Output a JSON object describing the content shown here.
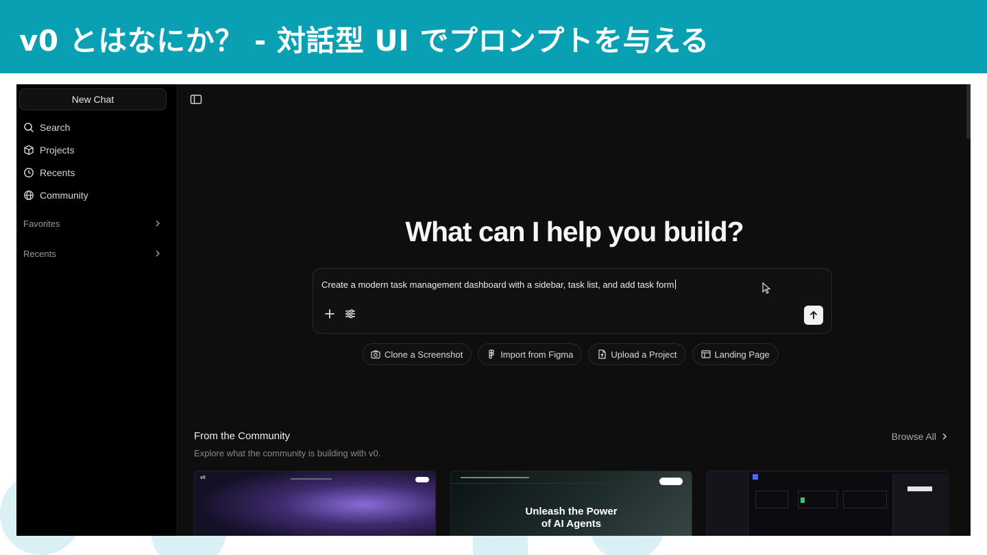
{
  "slide": {
    "title": "v0 とはなにか？ - 対話型 UI でプロンプトを与える"
  },
  "sidebar": {
    "new_chat": "New Chat",
    "items": [
      {
        "label": "Search",
        "icon": "search-icon"
      },
      {
        "label": "Projects",
        "icon": "cube-icon"
      },
      {
        "label": "Recents",
        "icon": "clock-icon"
      },
      {
        "label": "Community",
        "icon": "globe-icon"
      }
    ],
    "sections": [
      {
        "label": "Favorites",
        "icon": "chevron-right-icon"
      },
      {
        "label": "Recents",
        "icon": "chevron-right-icon"
      }
    ]
  },
  "main": {
    "heading": "What can I help you build?",
    "prompt_text": "Create a modern task management dashboard with a sidebar, task list, and add task form",
    "chips": [
      {
        "label": "Clone a Screenshot",
        "icon": "camera-icon"
      },
      {
        "label": "Import from Figma",
        "icon": "figma-icon"
      },
      {
        "label": "Upload a Project",
        "icon": "file-upload-icon"
      },
      {
        "label": "Landing Page",
        "icon": "layout-icon"
      }
    ],
    "community": {
      "title": "From the Community",
      "subtitle": "Explore what the community is building with v0.",
      "browse_all": "Browse All"
    },
    "cards": [
      {
        "caption": ""
      },
      {
        "caption_line1": "Unleash the Power",
        "caption_line2": "of AI Agents"
      },
      {
        "caption": ""
      }
    ]
  },
  "colors": {
    "slide_header": "#0aa0b4",
    "app_background": "#0e0e0e",
    "sidebar_background": "#000000"
  }
}
